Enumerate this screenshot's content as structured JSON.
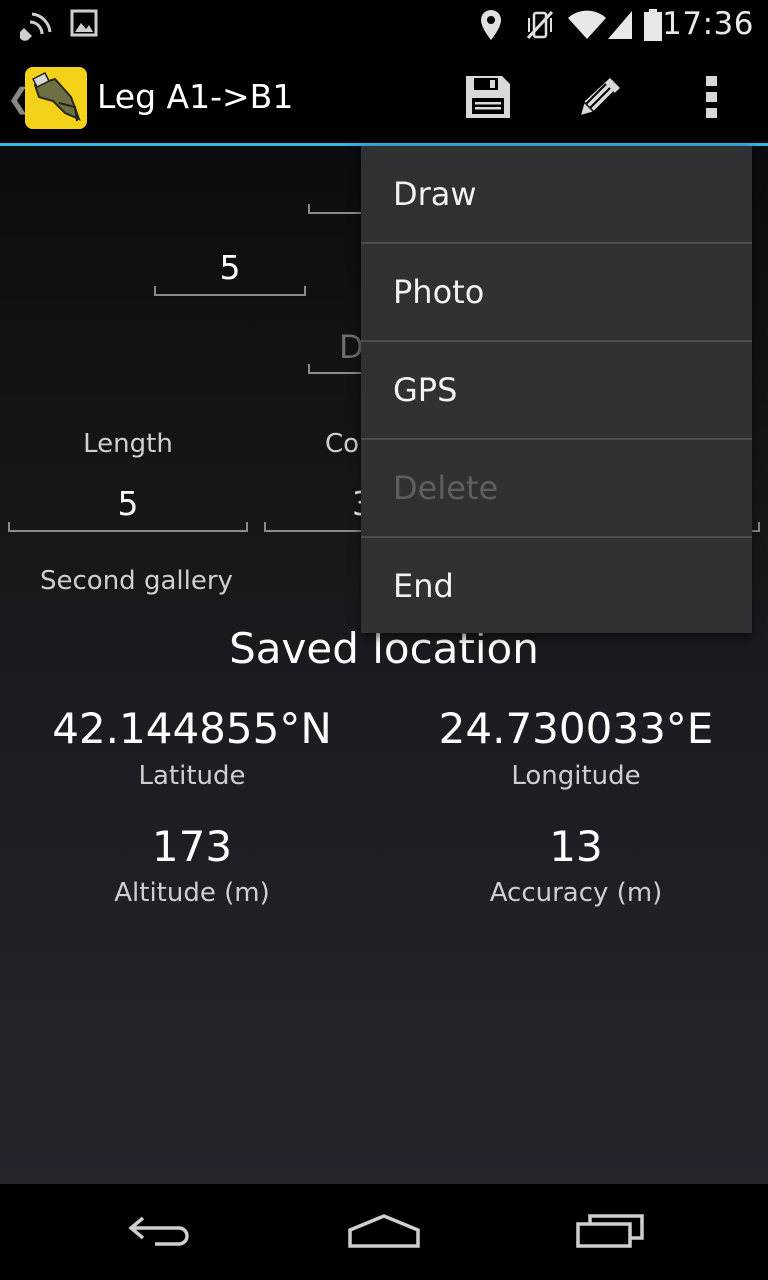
{
  "status_bar": {
    "time": "17:36",
    "icons": [
      "nfc-icon",
      "image-notification-icon",
      "location-icon",
      "vibrate-icon",
      "wifi-icon",
      "signal-icon",
      "battery-icon"
    ]
  },
  "action_bar": {
    "title": "Leg A1->B1",
    "icons": [
      "save-icon",
      "edit-icon",
      "overflow-menu-icon"
    ],
    "accent_color": "#33b5e5"
  },
  "form": {
    "top_value": "5",
    "partial_label": "D",
    "length_label": "Length",
    "length_value": "5",
    "partial_label2": "Co",
    "partial_value2": "3",
    "note": "Second gallery"
  },
  "saved_location": {
    "heading": "Saved location",
    "latitude_value": "42.144855°N",
    "latitude_label": "Latitude",
    "longitude_value": "24.730033°E",
    "longitude_label": "Longitude",
    "altitude_value": "173",
    "altitude_label": "Altitude (m)",
    "accuracy_value": "13",
    "accuracy_label": "Accuracy (m)"
  },
  "menu": {
    "items": [
      {
        "label": "Draw",
        "enabled": true
      },
      {
        "label": "Photo",
        "enabled": true
      },
      {
        "label": "GPS",
        "enabled": true
      },
      {
        "label": "Delete",
        "enabled": false
      },
      {
        "label": "End",
        "enabled": true
      }
    ]
  },
  "nav_bar": {
    "icons": [
      "back-icon",
      "home-icon",
      "recent-apps-icon"
    ]
  }
}
